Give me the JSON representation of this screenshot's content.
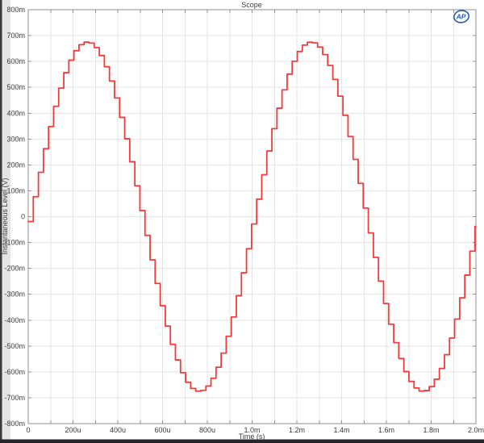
{
  "window": {
    "title": "Scope"
  },
  "frame": {
    "background": "#ffffff",
    "left_edge_color": "#3a3a3e",
    "left_gutter_color": "#e4e4e4",
    "bottom_bar_color": "#26262a"
  },
  "logo": {
    "text": "AP",
    "color": "#1d5fae"
  },
  "chart_data": {
    "type": "line",
    "title": "Scope",
    "xlabel": "Time (s)",
    "ylabel": "Instantaneous Level (V)",
    "xlim_s": [
      0,
      0.002
    ],
    "ylim_v": [
      -0.8,
      0.8
    ],
    "x_grid_step_s": 0.0001,
    "y_grid_step_v": 0.1,
    "grid": true,
    "x_ticks": [
      {
        "t_s": 0,
        "label": "0"
      },
      {
        "t_s": 0.0002,
        "label": "200u"
      },
      {
        "t_s": 0.0004,
        "label": "400u"
      },
      {
        "t_s": 0.0006,
        "label": "600u"
      },
      {
        "t_s": 0.0008,
        "label": "800u"
      },
      {
        "t_s": 0.001,
        "label": "1.0m"
      },
      {
        "t_s": 0.0012,
        "label": "1.2m"
      },
      {
        "t_s": 0.0014,
        "label": "1.4m"
      },
      {
        "t_s": 0.0016,
        "label": "1.6m"
      },
      {
        "t_s": 0.0018,
        "label": "1.8m"
      },
      {
        "t_s": 0.002,
        "label": "2.0m"
      }
    ],
    "y_ticks": [
      {
        "v": 0.8,
        "label": "800m"
      },
      {
        "v": 0.7,
        "label": "700m"
      },
      {
        "v": 0.6,
        "label": "600m"
      },
      {
        "v": 0.5,
        "label": "500m"
      },
      {
        "v": 0.4,
        "label": "400m"
      },
      {
        "v": 0.3,
        "label": "300m"
      },
      {
        "v": 0.2,
        "label": "200m"
      },
      {
        "v": 0.1,
        "label": "100m"
      },
      {
        "v": 0,
        "label": "0"
      },
      {
        "v": -0.1,
        "label": "-100m"
      },
      {
        "v": -0.2,
        "label": "-200m"
      },
      {
        "v": -0.3,
        "label": "-300m"
      },
      {
        "v": -0.4,
        "label": "-400m"
      },
      {
        "v": -0.5,
        "label": "-500m"
      },
      {
        "v": -0.6,
        "label": "-600m"
      },
      {
        "v": -0.7,
        "label": "-700m"
      },
      {
        "v": -0.8,
        "label": "-800m"
      }
    ],
    "colors": {
      "trace": "#f23b3b",
      "grid": "#e4e4e4",
      "axis": "#8f8f8f",
      "tick": "#8f8f8f",
      "text": "#3b3b3b"
    },
    "waveform": {
      "shape": "sine",
      "amplitude_v": 0.675,
      "frequency_hz": 1000,
      "phase_deg": -1.6,
      "sample_rate_hz": 44100,
      "hold": "zero-order-hold",
      "duration_s": 0.002,
      "periods_shown": 2,
      "peak_level_v_approx": 0.675,
      "peak_times_s": [
        0.00025,
        0.00125
      ],
      "trough_times_s": [
        0.00075,
        0.00175
      ]
    }
  }
}
